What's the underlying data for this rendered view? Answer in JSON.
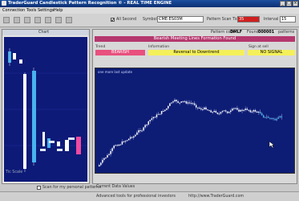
{
  "window": {
    "title": "TraderGuard Candlestick Pattern Recognition © - REAL TIME ENGINE",
    "controls": [
      "_",
      "□",
      "×"
    ]
  },
  "menu": [
    "Connection",
    "Tools",
    "Settings",
    "Help"
  ],
  "toolbar": {
    "all_second_label": "All Second",
    "all_second_checked": true,
    "symbol_label": "Symbol",
    "symbol_value": "CME:ES03M",
    "pattern_scan_label": "Pattern Scan Tick",
    "pattern_scan_value": "35",
    "interval_label": "Interval",
    "interval_value": "15"
  },
  "left_panel": {
    "title": "Chart",
    "personal_patterns_label": "Scan for my personal patterns",
    "bottom_label": "Tic Scale"
  },
  "right_panel": {
    "pattern_code_label": "Pattern code",
    "pattern_code_value": "DMLF",
    "found_label": "Found",
    "found_value": "000001",
    "found_suffix": "patterns",
    "banner": "Bearish Meeting Lines Formation Found",
    "trend_label": "Trend",
    "trend_value": "BEARISH",
    "information_label": "Information",
    "information_value": "Reversal to Downtrend",
    "signal_label": "Sign at sell",
    "signal_value": "NO SIGNAL",
    "chart_caption": "Current Data Values",
    "chart_corner_text": "one more last update"
  },
  "status_bar": {
    "left_text": "Advanced tools for professional investors",
    "right_text": "http://www.TraderGuard.com"
  },
  "colors": {
    "title_bar": "#0b2f73",
    "chart_bg": "#0d1c74",
    "banner": "#b5376d",
    "trend_box": "#e8507e",
    "info_box": "#f4f05a"
  },
  "icons": [
    "app-icon",
    "back-icon",
    "forward-icon",
    "refresh-icon",
    "zoom-in-icon",
    "zoom-out-icon",
    "settings-icon",
    "help-icon",
    "checkbox-icon",
    "mouse-cursor-icon"
  ]
}
